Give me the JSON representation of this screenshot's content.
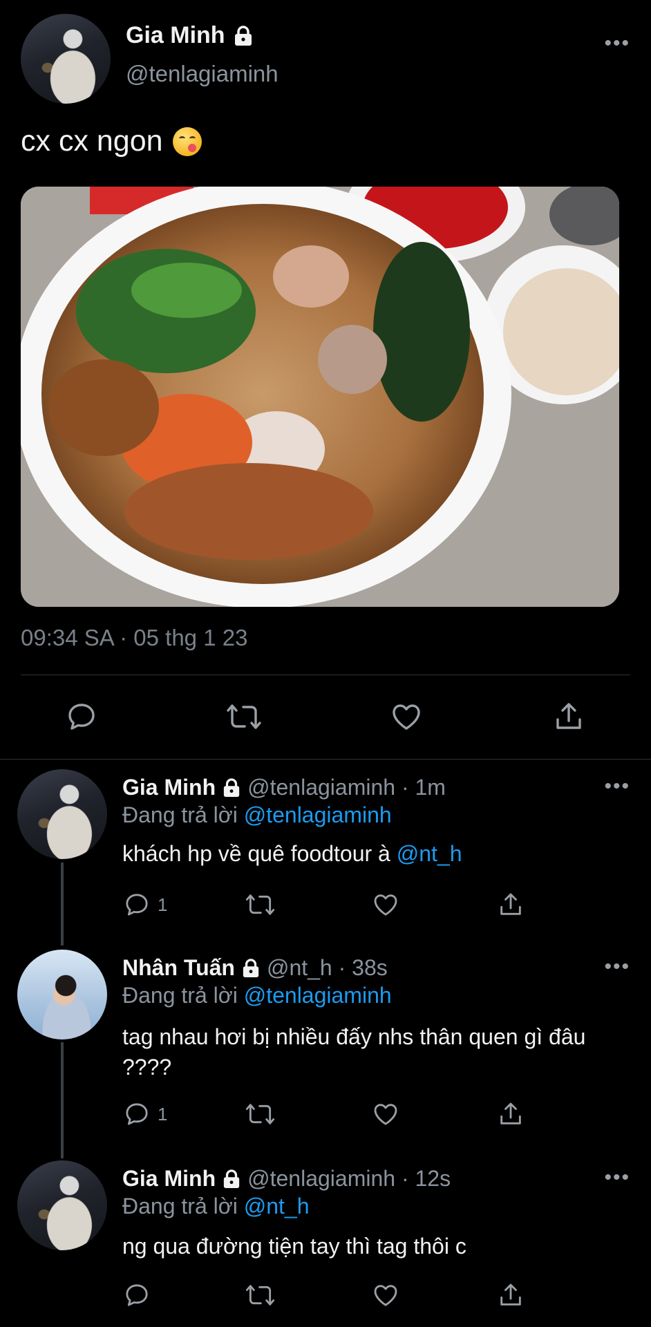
{
  "main_tweet": {
    "author_name": "Gia Minh",
    "author_handle": "@tenlagiaminh",
    "text": "cx cx ngon",
    "emoji_icon": "yum-face-icon",
    "timestamp": "09:34 SA · 05 thg 1 23"
  },
  "replies": [
    {
      "author_name": "Gia Minh",
      "meta": "@tenlagiaminh · 1m",
      "replying_prefix": "Đang trả lời",
      "replying_to": "@tenlagiaminh",
      "text": "khách hp về quê foodtour à",
      "text_mention": "@nt_h",
      "reply_count": "1",
      "avatar_icon": "avatar-gia-minh"
    },
    {
      "author_name": "Nhân Tuấn",
      "meta": "@nt_h · 38s",
      "replying_prefix": "Đang trả lời",
      "replying_to": "@tenlagiaminh",
      "text": "tag nhau hơi bị nhiều đấy nhs thân quen gì đâu ????",
      "text_mention": "",
      "reply_count": "1",
      "avatar_icon": "avatar-nhan-tuan"
    },
    {
      "author_name": "Gia Minh",
      "meta": "@tenlagiaminh · 12s",
      "replying_prefix": "Đang trả lời",
      "replying_to": "@nt_h",
      "text": "ng qua đường tiện tay thì tag thôi c",
      "text_mention": "",
      "reply_count": "",
      "avatar_icon": "avatar-gia-minh"
    }
  ],
  "colors": {
    "background": "#000000",
    "text_primary": "#f2f2f2",
    "text_secondary": "#8b949e",
    "mention_blue": "#1d9bf0",
    "divider": "#2f3336"
  }
}
